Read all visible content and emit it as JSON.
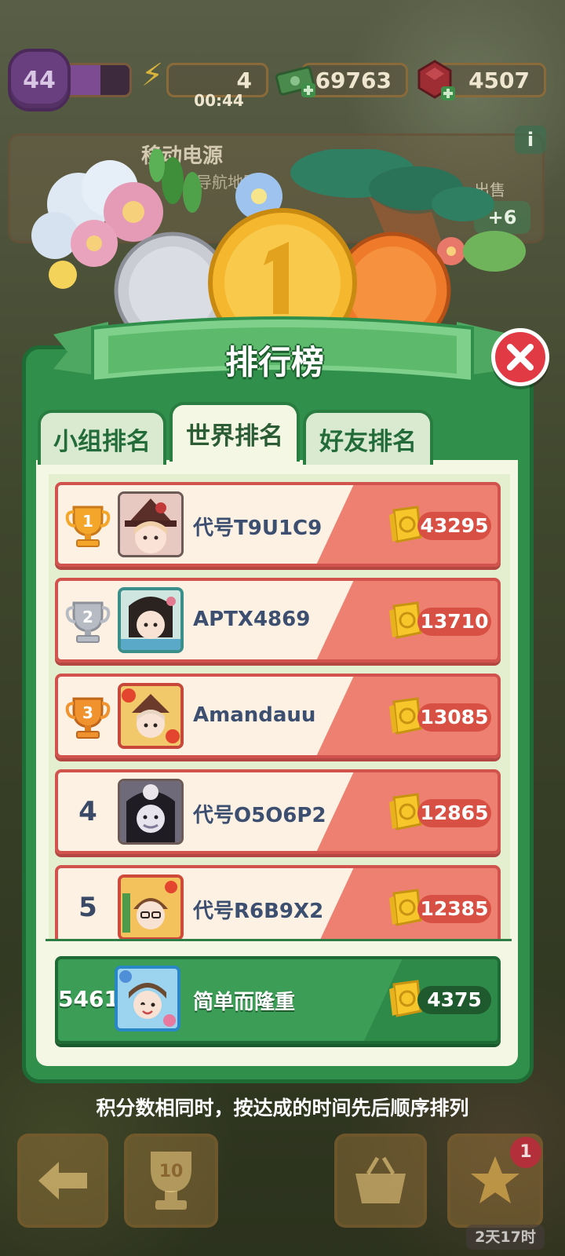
{
  "hud": {
    "level": "44",
    "level_progress": 0.6,
    "energy": "4",
    "energy_timer": "00:44",
    "cash": "69763",
    "gems": "4507"
  },
  "background_card": {
    "title": "移动电源",
    "subtitle": "导航地图",
    "info_label": "i",
    "sell_label": "出售",
    "sell_value": "+6"
  },
  "panel": {
    "title": "排行榜",
    "tabs": [
      {
        "label": "小组排名",
        "active": false
      },
      {
        "label": "世界排名",
        "active": true
      },
      {
        "label": "好友排名",
        "active": false
      }
    ]
  },
  "leaderboard": [
    {
      "rank": "1",
      "name": "代号T9U1C9",
      "score": "43295",
      "trophy": "gold"
    },
    {
      "rank": "2",
      "name": "APTX4869",
      "score": "13710",
      "trophy": "silver"
    },
    {
      "rank": "3",
      "name": "Amandauu",
      "score": "13085",
      "trophy": "bronze"
    },
    {
      "rank": "4",
      "name": "代号O5O6P2",
      "score": "12865",
      "trophy": "none"
    },
    {
      "rank": "5",
      "name": "代号R6B9X2",
      "score": "12385",
      "trophy": "none"
    }
  ],
  "my_entry": {
    "rank": "5461",
    "name": "简单而隆重",
    "score": "4375"
  },
  "footer_note": "积分数相同时，按达成的时间先后顺序排列",
  "bottom": {
    "trophy_count": "10",
    "badge_count": "1",
    "timer": "2天17时"
  },
  "colors": {
    "panel_green": "#2f8f4b",
    "row_salmon": "#ee8071",
    "close_red": "#e23a45",
    "gold": "#f5b72e"
  }
}
